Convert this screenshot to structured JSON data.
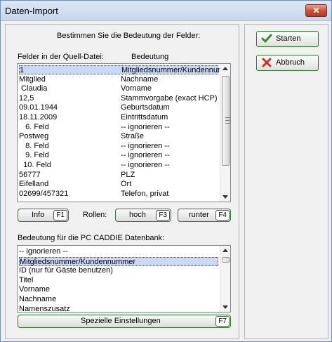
{
  "window": {
    "title": "Daten-Import",
    "close_glyph": "✕"
  },
  "main": {
    "heading": "Bestimmen Sie die Bedeutung der Felder:",
    "col_source": "Felder in der Quell-Datei:",
    "col_meaning": "Bedeutung",
    "rows": [
      {
        "source": "1",
        "meaning": "Mitgliedsnummer/Kundennummer",
        "selected": true
      },
      {
        "source": "Mitglied",
        "meaning": "Nachname"
      },
      {
        "source": " Claudia",
        "meaning": "Vorname"
      },
      {
        "source": "12,5",
        "meaning": "Stammvorgabe (exact HCP)"
      },
      {
        "source": "09.01.1944",
        "meaning": "Geburtsdatum"
      },
      {
        "source": "18.11.2009",
        "meaning": "Eintrittsdatum"
      },
      {
        "source": "   6. Feld",
        "meaning": "-- ignorieren --"
      },
      {
        "source": "Postweg",
        "meaning": "Straße"
      },
      {
        "source": "   8. Feld",
        "meaning": "-- ignorieren --"
      },
      {
        "source": "   9. Feld",
        "meaning": "-- ignorieren --"
      },
      {
        "source": "  10. Feld",
        "meaning": "-- ignorieren --"
      },
      {
        "source": "56777",
        "meaning": "PLZ"
      },
      {
        "source": "Eifelland",
        "meaning": "Ort"
      },
      {
        "source": "02699/457321",
        "meaning": "Telefon, privat"
      }
    ],
    "info_button": {
      "label": "Info",
      "key": "F1"
    },
    "rollen_label": "Rollen:",
    "hoch_button": {
      "label": "hoch",
      "key": "F3"
    },
    "runter_button": {
      "label": "runter",
      "key": "F4"
    },
    "db_heading": "Bedeutung für die PC CADDIE Datenbank:",
    "db_items": [
      {
        "label": "-- ignorieren --"
      },
      {
        "label": "Mitgliedsnummer/Kundennummer",
        "selected": true
      },
      {
        "label": "ID (nur für Gäste benutzen)"
      },
      {
        "label": "Titel"
      },
      {
        "label": "Vorname"
      },
      {
        "label": "Nachname"
      },
      {
        "label": "Namenszusatz"
      }
    ],
    "special_button": {
      "label": "Spezielle Einstellungen",
      "key": "F7"
    }
  },
  "side": {
    "start_button": {
      "label": "Starten",
      "icon": "checkmark-icon",
      "color": "#2f8f2f"
    },
    "cancel_button": {
      "label": "Abbruch",
      "icon": "cross-icon",
      "color": "#d3301f"
    }
  }
}
